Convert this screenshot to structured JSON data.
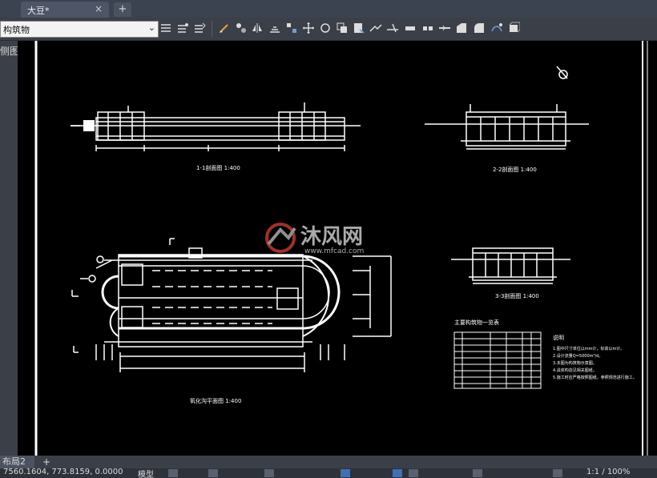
{
  "tabs": {
    "document_title": "大豆*",
    "close_glyph": "×",
    "new_tab_glyph": "+"
  },
  "toolbar": {
    "layer_combo_value": "构筑物",
    "layer_combo_arrow": "⌄",
    "icons": [
      "layer-state-icon",
      "layer-match-icon",
      "layer-previous-icon",
      "brush-icon",
      "mirror-icon",
      "array-icon",
      "offset-icon",
      "align-icon",
      "move-icon",
      "rotate-icon",
      "copy-icon",
      "scale-icon",
      "stretch-icon",
      "trim-icon",
      "extend-icon",
      "break-icon",
      "join-icon",
      "chamfer-icon",
      "fillet-icon",
      "explode-icon",
      "blend-icon"
    ]
  },
  "left_panel": {
    "label": "侧图"
  },
  "drawing": {
    "label_section_1": "1-1剖面图  1:400",
    "label_section_2": "2-2剖面图  1:400",
    "label_section_3": "3-3剖面图  1:400",
    "label_plan": "氧化沟平面图  1:400",
    "table_title": "主要构筑物一览表",
    "notes_title": "说明",
    "watermark_text": "沐风网",
    "watermark_url": "www.mfcad.com",
    "notes": [
      "1.图中尺寸单位以mm计，标高以m计。",
      "2.设计流量Q=5000m³/d。",
      "3.本图为构筑物示意图。",
      "4.具体构造见相关图纸。",
      "5.施工时应严格按照图纸，参照规范进行施工。"
    ]
  },
  "layout_tabs": {
    "current": "布局2",
    "add": "+"
  },
  "statusbar": {
    "coords": "7560.1604, 773.8159, 0.0000",
    "model": "模型",
    "zoom": "1:1 / 100%"
  },
  "colors": {
    "background": "#000000",
    "lines": "#ffffff",
    "chrome": "#3a3f48",
    "tab_active": "#4d5566"
  }
}
